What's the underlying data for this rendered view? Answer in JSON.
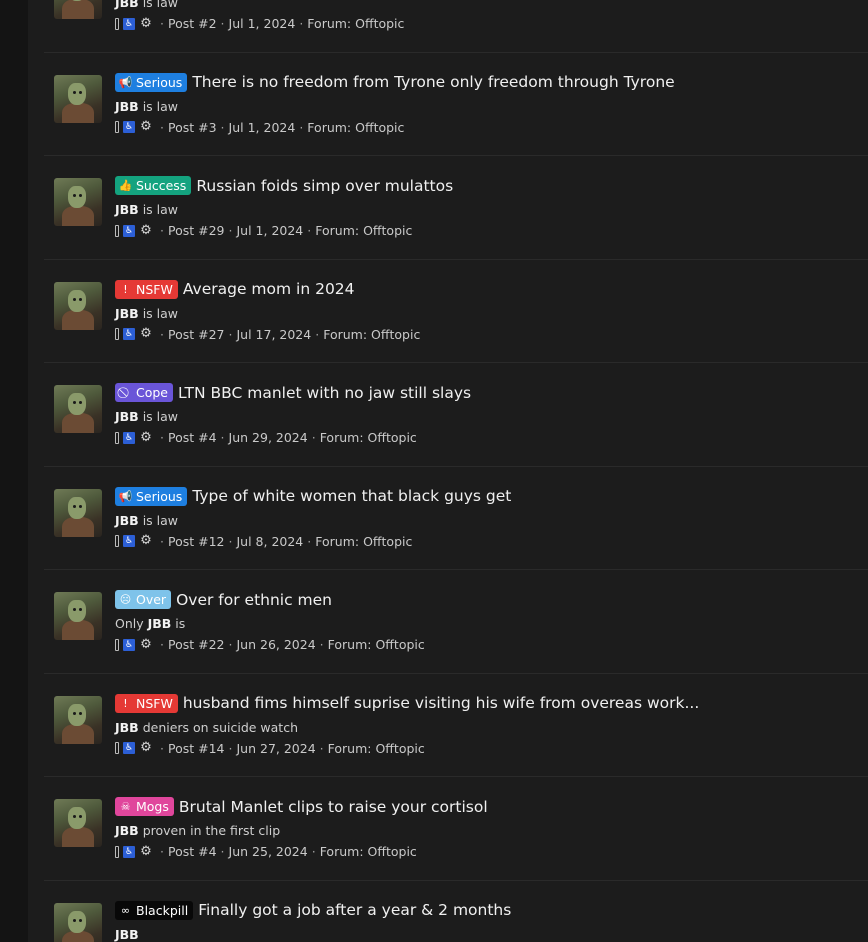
{
  "results": [
    {
      "badge": null,
      "title": "",
      "snippet": {
        "prefix": "",
        "bold": "JBB",
        "suffix": " is law"
      },
      "post": "Post #2",
      "date": "Jul 1, 2024",
      "forum_label": "Forum:",
      "forum": "Offtopic"
    },
    {
      "badge": {
        "label": "Serious",
        "icon": "megaphone-icon",
        "glyph": "📢",
        "color": "#1e7fe0"
      },
      "title": "There is no freedom from Tyrone only freedom through Tyrone",
      "snippet": {
        "prefix": "",
        "bold": "JBB",
        "suffix": " is law"
      },
      "post": "Post #3",
      "date": "Jul 1, 2024",
      "forum_label": "Forum:",
      "forum": "Offtopic"
    },
    {
      "badge": {
        "label": "Success",
        "icon": "thumbs-up-icon",
        "glyph": "👍",
        "color": "#14a37f"
      },
      "title": "Russian foids simp over mulattos",
      "snippet": {
        "prefix": "",
        "bold": "JBB",
        "suffix": " is law"
      },
      "post": "Post #29",
      "date": "Jul 1, 2024",
      "forum_label": "Forum:",
      "forum": "Offtopic"
    },
    {
      "badge": {
        "label": "NSFW",
        "icon": "exclamation-circle-icon",
        "glyph": "!",
        "color": "#e53935"
      },
      "title": "Average mom in 2024",
      "snippet": {
        "prefix": "",
        "bold": "JBB",
        "suffix": " is law"
      },
      "post": "Post #27",
      "date": "Jul 17, 2024",
      "forum_label": "Forum:",
      "forum": "Offtopic"
    },
    {
      "badge": {
        "label": "Cope",
        "icon": "ban-icon",
        "glyph": "⃠",
        "color": "#6a55d8"
      },
      "title": "LTN BBC manlet with no jaw still slays",
      "snippet": {
        "prefix": "",
        "bold": "JBB",
        "suffix": " is law"
      },
      "post": "Post #4",
      "date": "Jun 29, 2024",
      "forum_label": "Forum:",
      "forum": "Offtopic"
    },
    {
      "badge": {
        "label": "Serious",
        "icon": "megaphone-icon",
        "glyph": "📢",
        "color": "#1e7fe0"
      },
      "title": "Type of white women that black guys get",
      "snippet": {
        "prefix": "",
        "bold": "JBB",
        "suffix": " is law"
      },
      "post": "Post #12",
      "date": "Jul 8, 2024",
      "forum_label": "Forum:",
      "forum": "Offtopic"
    },
    {
      "badge": {
        "label": "Over",
        "icon": "sad-face-icon",
        "glyph": "☹",
        "color": "#7ec3ea"
      },
      "title": "Over for ethnic men",
      "snippet": {
        "prefix": "Only ",
        "bold": "JBB",
        "suffix": " is"
      },
      "post": "Post #22",
      "date": "Jun 26, 2024",
      "forum_label": "Forum:",
      "forum": "Offtopic"
    },
    {
      "badge": {
        "label": "NSFW",
        "icon": "exclamation-circle-icon",
        "glyph": "!",
        "color": "#e53935"
      },
      "title": "husband fims himself suprise visiting his wife from overeas work...",
      "snippet": {
        "prefix": "",
        "bold": "JBB",
        "suffix": " deniers on suicide watch"
      },
      "post": "Post #14",
      "date": "Jun 27, 2024",
      "forum_label": "Forum:",
      "forum": "Offtopic"
    },
    {
      "badge": {
        "label": "Mogs",
        "icon": "skull-icon",
        "glyph": "☠",
        "color": "#e0469c"
      },
      "title": "Brutal Manlet clips to raise your cortisol",
      "snippet": {
        "prefix": "",
        "bold": "JBB",
        "suffix": " proven in the first clip"
      },
      "post": "Post #4",
      "date": "Jun 25, 2024",
      "forum_label": "Forum:",
      "forum": "Offtopic"
    },
    {
      "badge": {
        "label": "Blackpill",
        "icon": "binoculars-icon",
        "glyph": "∞",
        "color": "#080808"
      },
      "title": "Finally got a job after a year & 2 months",
      "snippet": {
        "prefix": "",
        "bold": "JBB",
        "suffix": ""
      },
      "post": "",
      "date": "",
      "forum_label": "",
      "forum": ""
    }
  ],
  "meta_icons": [
    "clip-icon",
    "wheelchair-icon",
    "gear-icon"
  ],
  "separator": "·"
}
